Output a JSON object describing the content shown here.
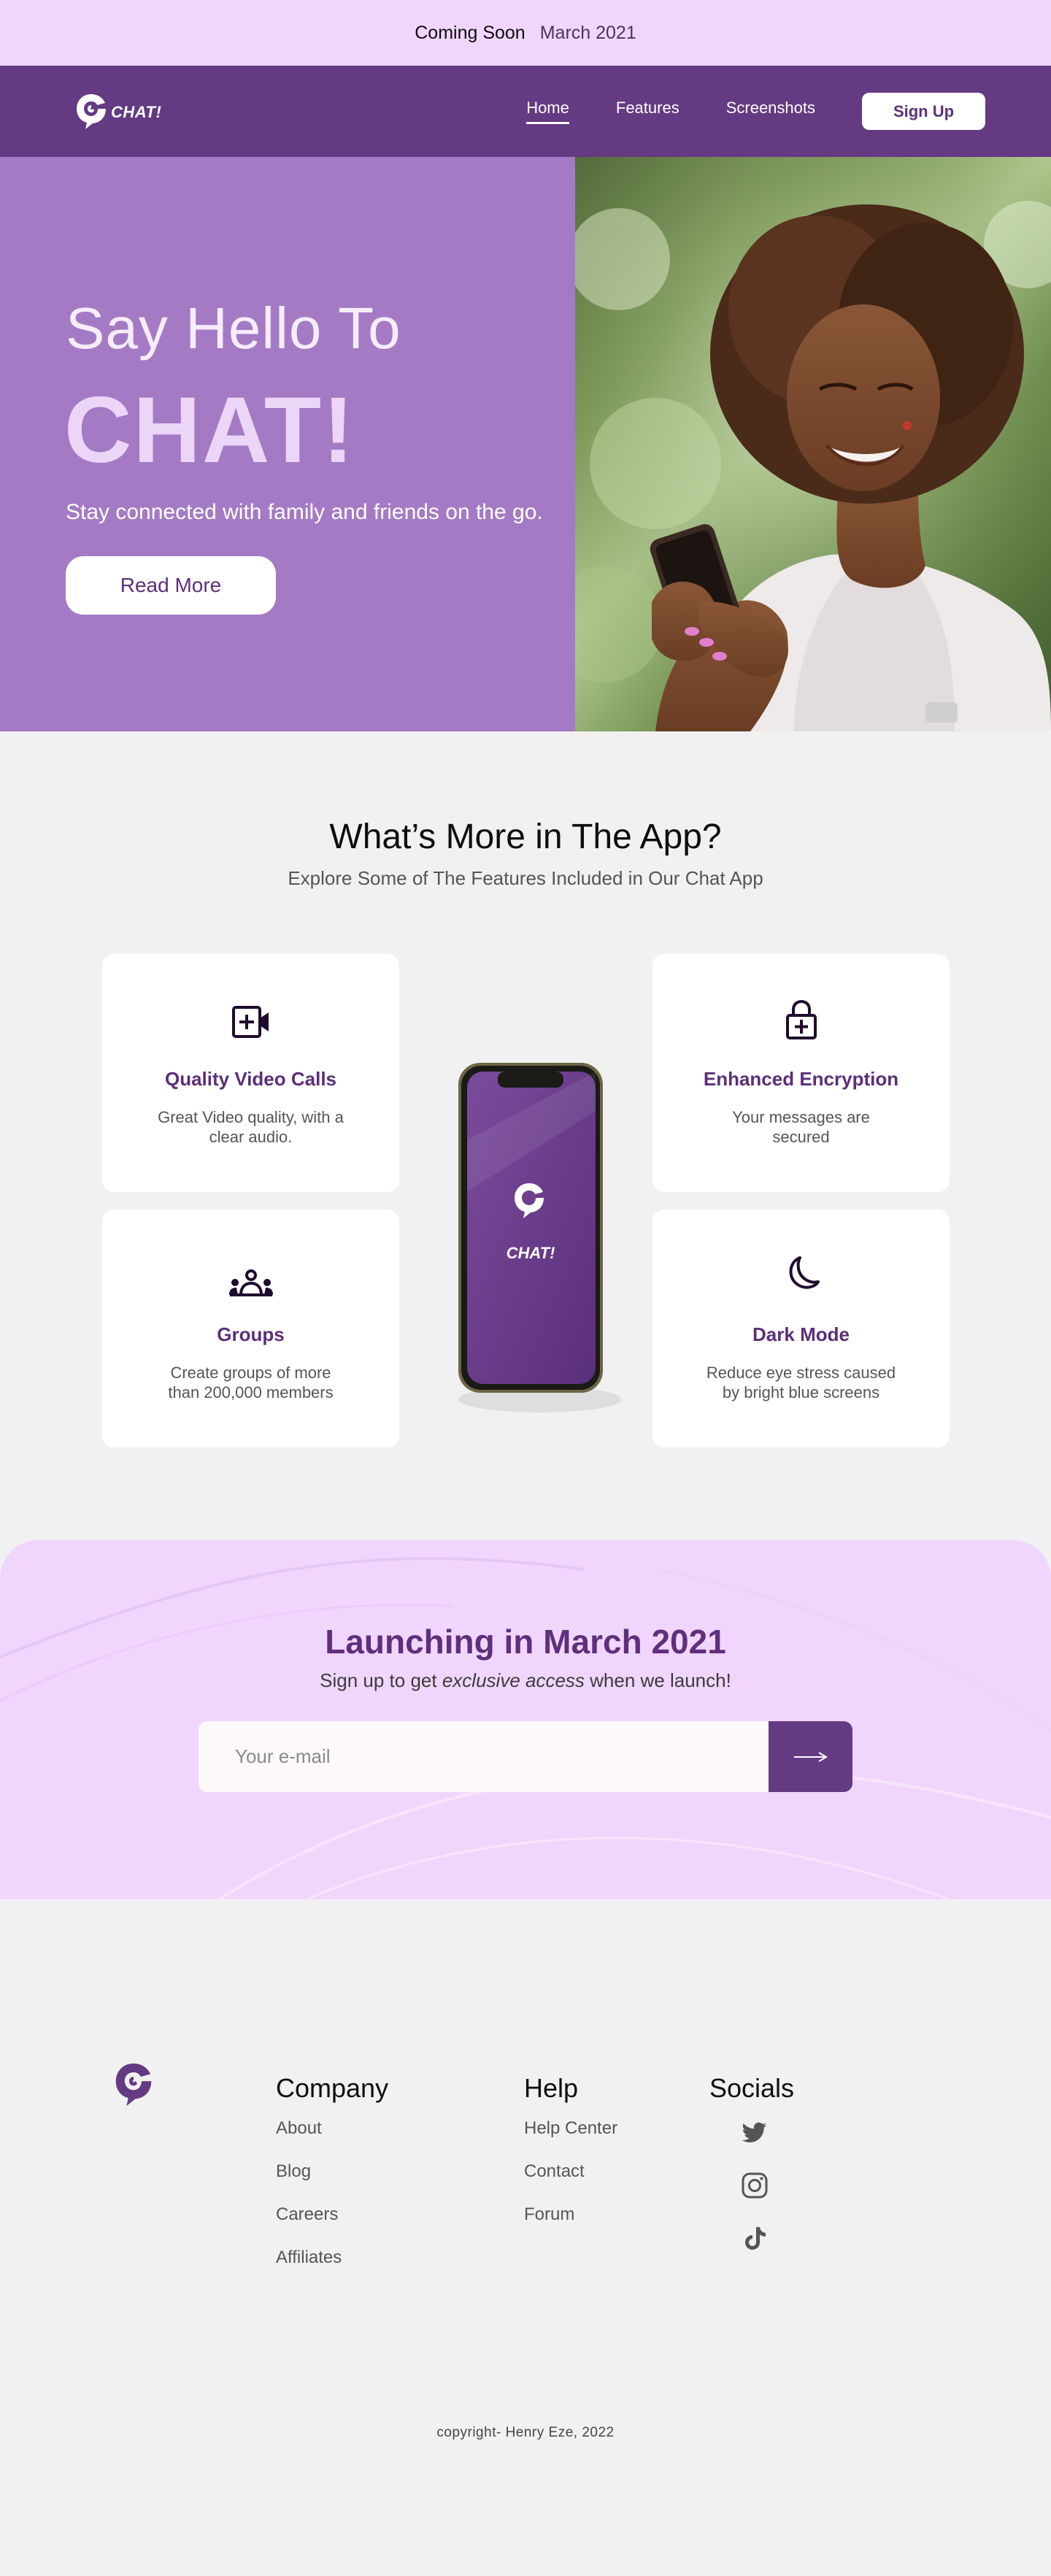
{
  "announcement": {
    "label": "Coming Soon",
    "date": "March 2021"
  },
  "nav": {
    "logo_text": "CHAT!",
    "links": [
      "Home",
      "Features",
      "Screenshots"
    ],
    "active_link": "Home",
    "signup_label": "Sign Up"
  },
  "hero": {
    "greeting": "Say Hello To",
    "brand": "CHAT!",
    "subtitle": "Stay connected with family and friends on the go.",
    "cta_label": "Read More"
  },
  "features": {
    "title": "What’s More in The App?",
    "subtitle": "Explore Some of The Features Included in Our Chat App",
    "cards": [
      {
        "icon": "video-call-icon",
        "title": "Quality Video Calls",
        "text": "Great Video quality, with a clear audio."
      },
      {
        "icon": "lock-icon",
        "title": "Enhanced Encryption",
        "text": "Your messages are secured"
      },
      {
        "icon": "group-icon",
        "title": "Groups",
        "text": "Create groups of more than 200,000 members"
      },
      {
        "icon": "moon-icon",
        "title": "Dark Mode",
        "text": "Reduce eye stress caused by bright blue screens"
      }
    ],
    "phone_screen_text": "CHAT!"
  },
  "launch": {
    "title": "Launching in March 2021",
    "subtitle_before": "Sign up to get ",
    "subtitle_emphasis": "exclusive access",
    "subtitle_after": " when we launch!",
    "email_placeholder": "Your e-mail",
    "submit_icon": "arrow-right-icon"
  },
  "footer": {
    "columns": [
      {
        "heading": "Company",
        "links": [
          "About",
          "Blog",
          "Careers",
          "Affiliates"
        ]
      },
      {
        "heading": "Help",
        "links": [
          "Help Center",
          "Contact",
          "Forum"
        ]
      }
    ],
    "socials_heading": "Socials",
    "socials": [
      "twitter-icon",
      "instagram-icon",
      "tiktok-icon"
    ],
    "copyright": "copyright- Henry Eze, 2022"
  },
  "colors": {
    "brand_purple": "#643a82",
    "hero_purple": "#a47ac4",
    "light_lilac": "#f0d6fc",
    "page_bg": "#f1f1f1"
  }
}
